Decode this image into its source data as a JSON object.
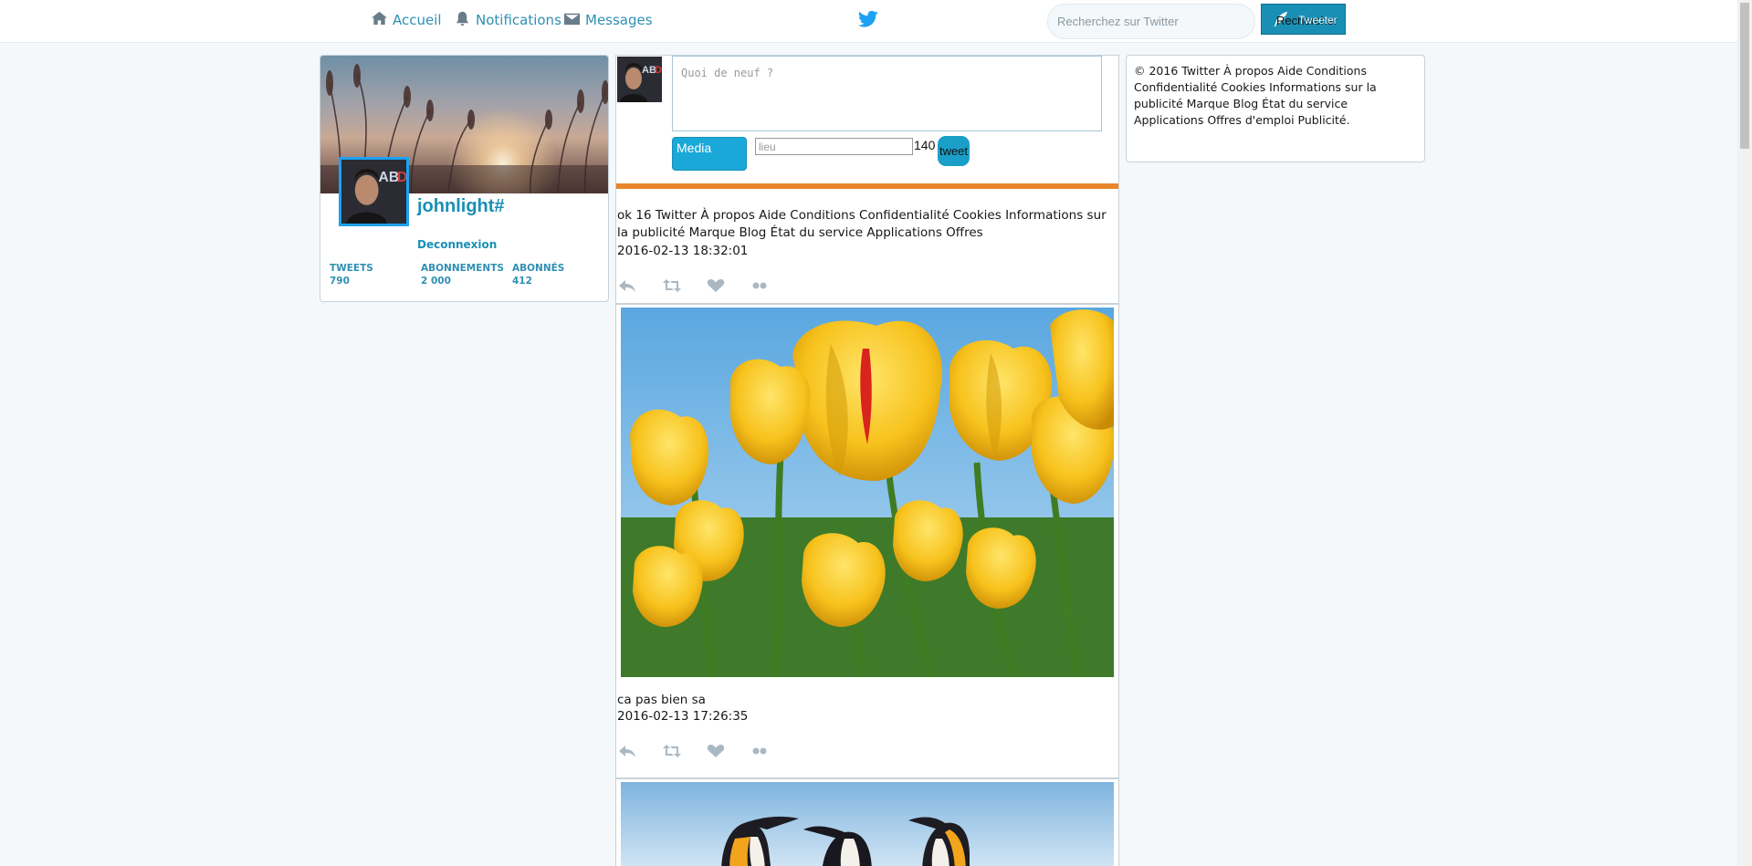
{
  "nav": {
    "home_label": "Accueil",
    "notifications_label": "Notifications",
    "messages_label": "Messages"
  },
  "search": {
    "placeholder": "Recherchez sur Twitter",
    "button_label_a": "Rechercher",
    "button_label_b": "Tweeter"
  },
  "profile": {
    "username": "johnlight#",
    "logout_label": "Deconnexion",
    "avatar_text": "ABD",
    "stats": {
      "tweets_label": "TWEETS",
      "tweets_value": "790",
      "following_label": "ABONNEMENTS",
      "following_value": "2 000",
      "followers_label": "ABONNÉS",
      "followers_value": "412"
    }
  },
  "composer": {
    "placeholder": "Quoi de neuf ?",
    "media_label": "Media",
    "location_placeholder": "lieu",
    "char_count": "140",
    "tweet_label": "tweet"
  },
  "tweets": [
    {
      "text": "ok 16 Twitter À propos Aide Conditions Confidentialité Cookies Informations sur la publicité Marque Blog État du service Applications Offres",
      "date": "2016-02-13 18:32:01"
    },
    {
      "text": "ca pas bien sa",
      "date": "2016-02-13 17:26:35"
    }
  ],
  "footer": {
    "text": "© 2016 Twitter À propos Aide Conditions Confidentialité Cookies Informations sur la publicité Marque Blog État du service Applications Offres d'emploi Publicité."
  },
  "colors": {
    "accent": "#1da1f2",
    "link": "#1a8fb5",
    "divider_orange": "#e8862b"
  },
  "icons": {
    "home": "home-icon",
    "notifications": "bell-icon",
    "messages": "envelope-icon",
    "logo": "twitter-bird-icon",
    "reply": "reply-icon",
    "retweet": "retweet-icon",
    "like": "heart-icon",
    "more": "more-icon"
  }
}
